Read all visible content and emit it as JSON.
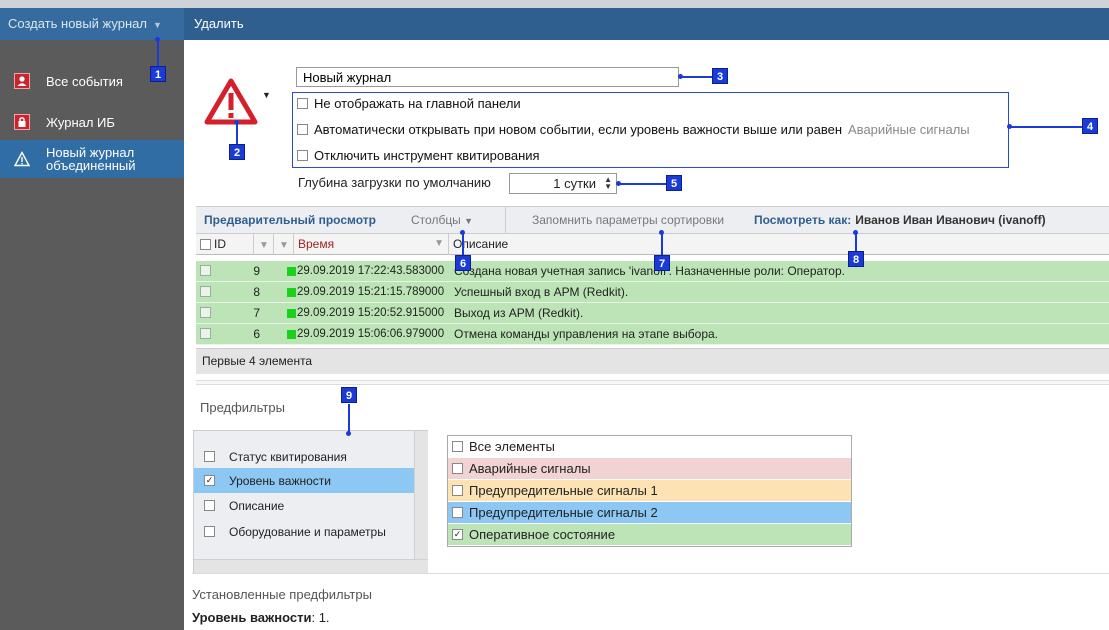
{
  "topbar": {
    "create_label": "Создать новый журнал",
    "delete_label": "Удалить"
  },
  "sidebar": {
    "items": [
      {
        "label": "Все события",
        "icon": "person-red-icon"
      },
      {
        "label": "Журнал ИБ",
        "icon": "lock-red-icon"
      },
      {
        "label_line1": "Новый журнал",
        "label_line2": "объединенный",
        "icon": "warning-triangle-icon"
      }
    ]
  },
  "journal": {
    "name_value": "Новый журнал",
    "opt_hide_main": "Не отображать на главной панели",
    "opt_auto_open": "Автоматически открывать при новом событии, если уровень важности выше или равен",
    "opt_auto_open_level": "Аварийные сигналы",
    "opt_disable_ack": "Отключить инструмент квитирования",
    "depth_label": "Глубина загрузки по умолчанию",
    "depth_value": "1 сутки"
  },
  "grid_toolbar": {
    "preview": "Предварительный просмотр",
    "columns": "Столбцы",
    "remember_sort": "Запомнить параметры сортировки",
    "view_as": "Посмотреть как:",
    "user": "Иванов Иван Иванович (ivanoff)"
  },
  "grid": {
    "columns": [
      "ID",
      "Время",
      "Описание"
    ],
    "rows": [
      {
        "id": "9",
        "time": "29.09.2019 17:22:43.583000",
        "desc": "Создана новая учетная запись 'ivanoff'. Назначенные роли: Оператор."
      },
      {
        "id": "8",
        "time": "29.09.2019 15:21:15.789000",
        "desc": "Успешный вход в АРМ (Redkit)."
      },
      {
        "id": "7",
        "time": "29.09.2019 15:20:52.915000",
        "desc": "Выход из АРМ (Redkit)."
      },
      {
        "id": "6",
        "time": "29.09.2019 15:06:06.979000",
        "desc": "Отмена команды управления на этапе выбора."
      }
    ],
    "footer": "Первые 4 элемента"
  },
  "prefilters": {
    "title": "Предфильтры",
    "items": [
      {
        "label": "Статус квитирования",
        "checked": false
      },
      {
        "label": "Уровень важности",
        "checked": true
      },
      {
        "label": "Описание",
        "checked": false
      },
      {
        "label": "Оборудование и параметры",
        "checked": false
      }
    ],
    "levels": [
      {
        "label": "Все элементы",
        "checked": false,
        "color": "#ffffff"
      },
      {
        "label": "Аварийные сигналы",
        "checked": false,
        "color": "#f2d3d3"
      },
      {
        "label": "Предупредительные сигналы 1",
        "checked": false,
        "color": "#fde3b3"
      },
      {
        "label": "Предупредительные сигналы 2",
        "checked": false,
        "color": "#8dc8f5"
      },
      {
        "label": "Оперативное состояние",
        "checked": true,
        "color": "#bde4b6"
      }
    ]
  },
  "installed": {
    "title": "Установленные предфильтры",
    "key": "Уровень важности",
    "value": ": 1."
  },
  "callouts": [
    "1",
    "2",
    "3",
    "4",
    "5",
    "6",
    "7",
    "8",
    "9"
  ],
  "colors": {
    "accent": "#2f5f8f",
    "callout": "#1b3bd6",
    "row_green": "#bde4b6",
    "alarm_red": "#c8262e"
  }
}
